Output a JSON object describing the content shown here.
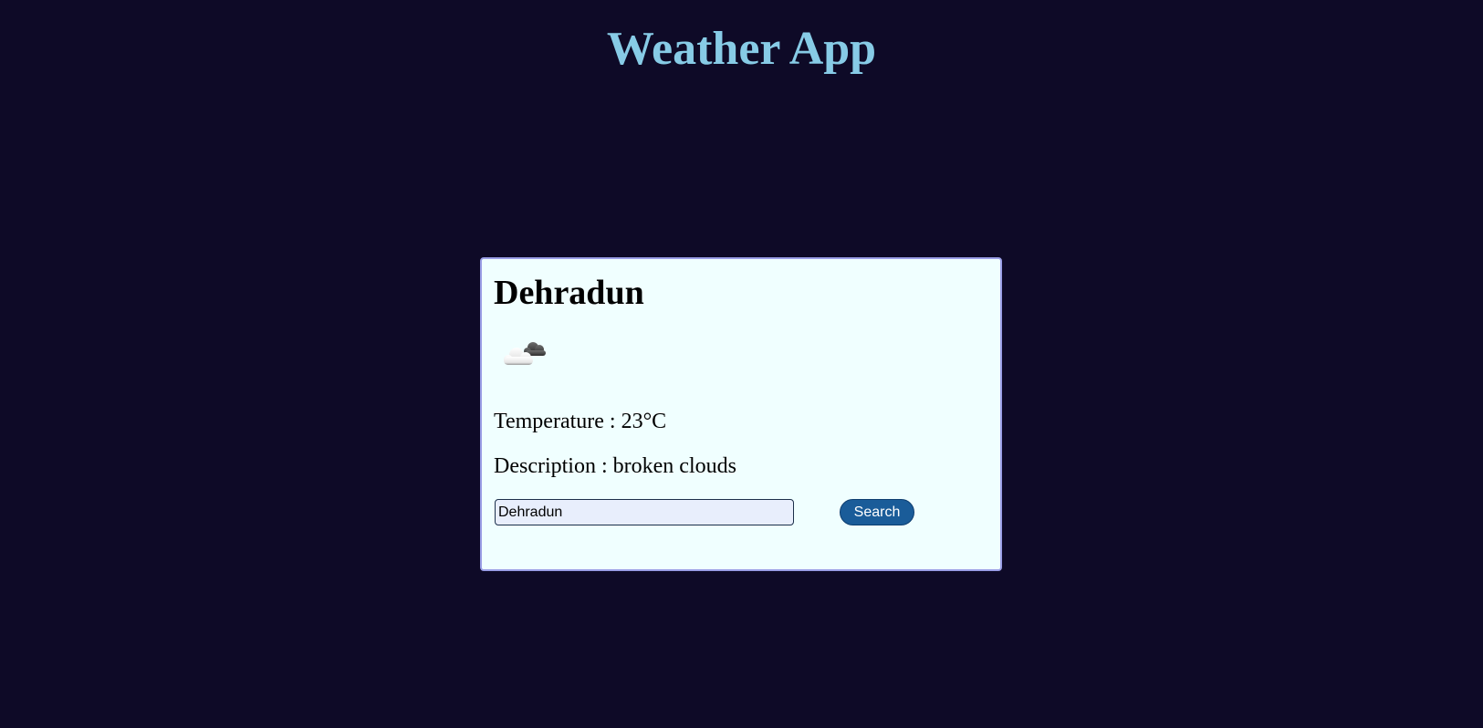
{
  "header": {
    "title": "Weather App"
  },
  "weather": {
    "city": "Dehradun",
    "icon": "broken-clouds-icon",
    "temperature_text": "Temperature : 23°C",
    "description_text": "Description : broken clouds"
  },
  "search": {
    "input_value": "Dehradun",
    "button_label": "Search"
  },
  "colors": {
    "background": "#0e0a27",
    "title": "#87cbe6",
    "card_background": "#f0ffff",
    "card_border": "#9a9ee6",
    "button": "#1a5c99"
  }
}
